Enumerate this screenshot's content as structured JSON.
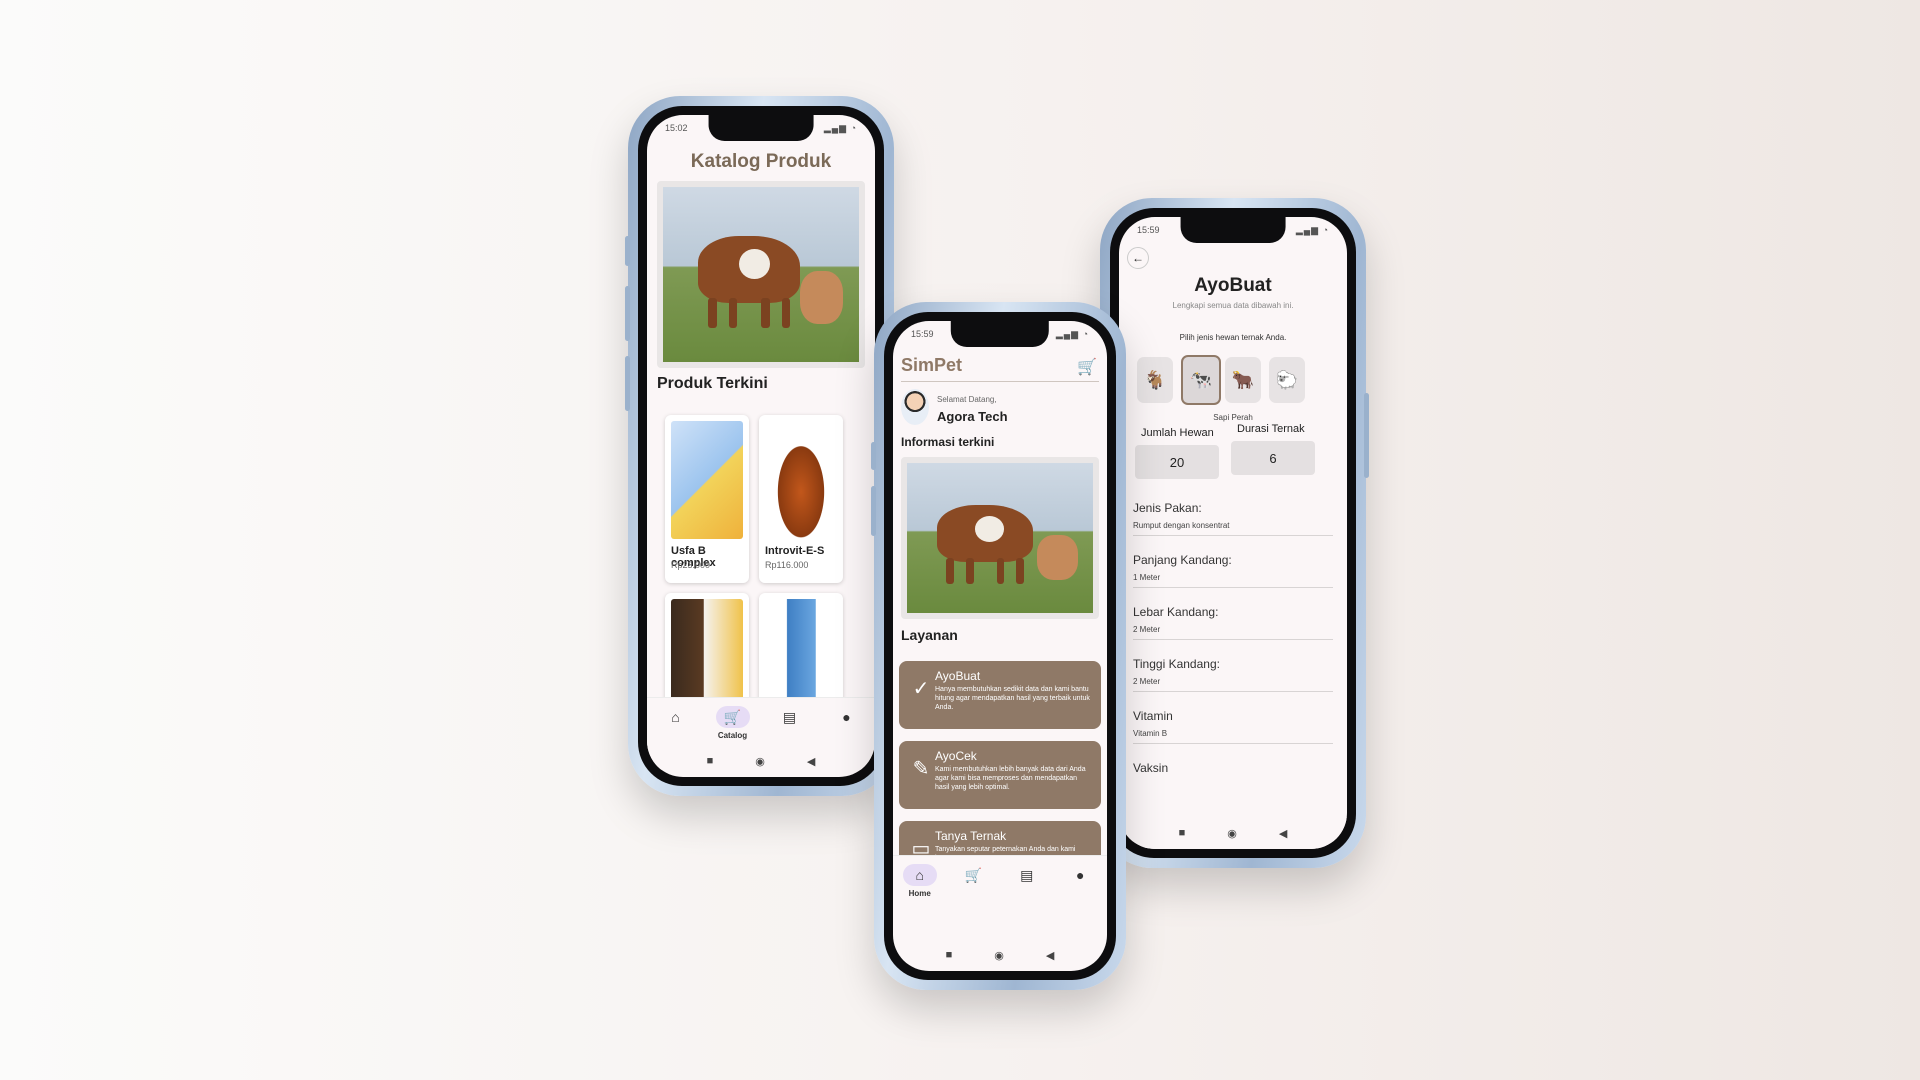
{
  "catalog_phone": {
    "status_time": "15:02",
    "title": "Katalog Produk",
    "section_title": "Produk Terkini",
    "products": [
      {
        "name": "Usfa B complex",
        "price": "Rp23.000"
      },
      {
        "name": "Introvit-E-S",
        "price": "Rp116.000"
      },
      {
        "name": "",
        "price": ""
      },
      {
        "name": "",
        "price": ""
      }
    ],
    "nav": {
      "active_label": "Catalog"
    }
  },
  "home_phone": {
    "status_time": "15:59",
    "app_title": "SimPet",
    "greeting": "Selamat Datang,",
    "user_name": "Agora Tech",
    "info_title": "Informasi terkini",
    "services_title": "Layanan",
    "services": [
      {
        "title": "AyoBuat",
        "desc": "Hanya membutuhkan sedikit data dan kami bantu hitung agar mendapatkan hasil yang terbaik untuk Anda."
      },
      {
        "title": "AyoCek",
        "desc": "Kami membutuhkan lebih banyak data dari Anda agar kami bisa memproses dan mendapatkan hasil yang lebih optimal."
      },
      {
        "title": "Tanya Ternak",
        "desc": "Tanyakan seputar peternakan Anda dan kami bantu"
      }
    ],
    "nav": {
      "active_label": "Home"
    }
  },
  "form_phone": {
    "status_time": "15:59",
    "title": "AyoBuat",
    "subtitle": "Lengkapi semua data dibawah ini.",
    "animal_prompt": "Pilih jenis hewan ternak Anda.",
    "selected_animal": "Sapi Perah",
    "jumlah_label": "Jumlah Hewan",
    "jumlah_value": "20",
    "durasi_label": "Durasi Ternak",
    "durasi_value": "6",
    "fields": [
      {
        "label": "Jenis Pakan:",
        "value": "Rumput dengan konsentrat"
      },
      {
        "label": "Panjang Kandang:",
        "value": "1 Meter"
      },
      {
        "label": "Lebar Kandang:",
        "value": "2 Meter"
      },
      {
        "label": "Tinggi Kandang:",
        "value": "2 Meter"
      },
      {
        "label": "Vitamin",
        "value": "Vitamin B"
      },
      {
        "label": "Vaksin",
        "value": ""
      }
    ]
  }
}
